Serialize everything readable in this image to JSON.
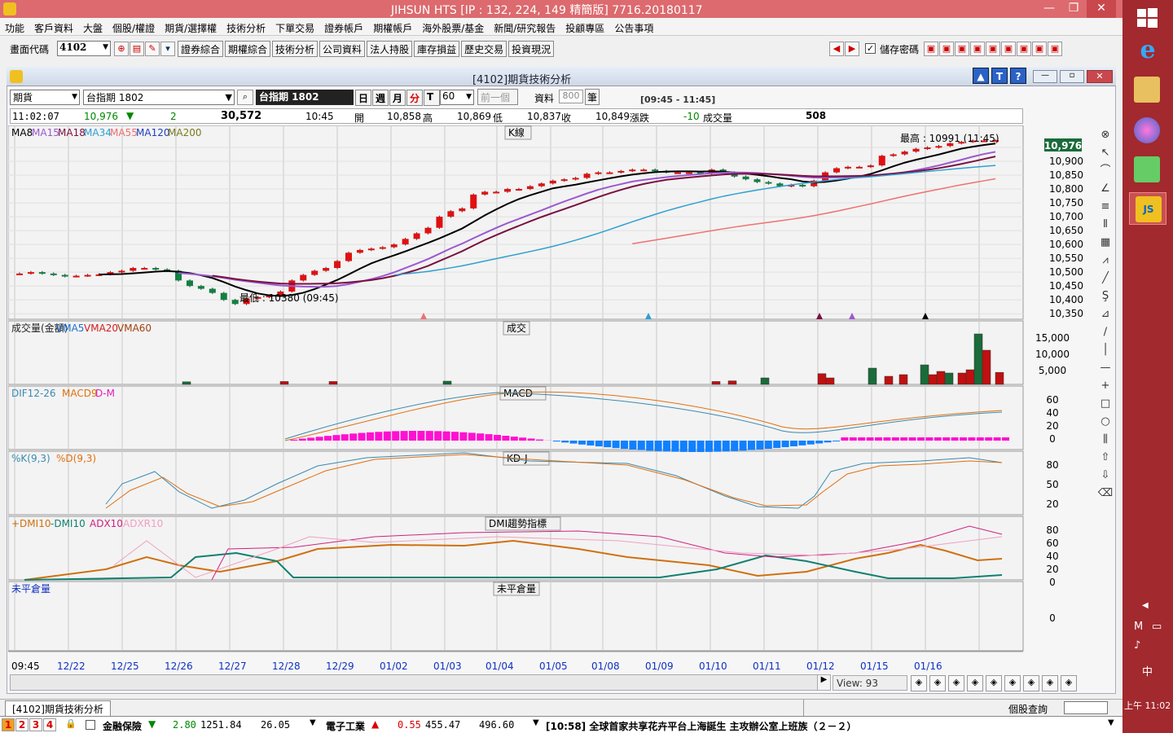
{
  "title": "JIHSUN HTS     [IP : 132, 224, 149 精簡版] 7716.20180117",
  "menu": [
    "功能",
    "客戶資料",
    "大盤",
    "個股/權證",
    "期貨/選擇權",
    "技術分析",
    "下單交易",
    "證券帳戶",
    "期權帳戶",
    "海外股票/基金",
    "新聞/研究報告",
    "投顧專區",
    "公告事項"
  ],
  "toolbar": {
    "code_label": "畫面代碼",
    "code_value": "4102",
    "buttons": [
      "證券綜合",
      "期權綜合",
      "技術分析",
      "公司資料",
      "法人持股",
      "庫存損益",
      "歷史交易",
      "投資現況"
    ],
    "save_pw": "儲存密碼"
  },
  "window": {
    "title": "[4102]期貨技術分析"
  },
  "controls": {
    "type": "期貨",
    "symbol": "台指期 1802",
    "symbol_name": "台指期 1802",
    "periods": [
      "日",
      "週",
      "月",
      "分",
      "T"
    ],
    "interval": "60",
    "prev": "前一個",
    "data_label": "資料",
    "data_count": "800",
    "unit": "筆",
    "range": "[09:45 - 11:45]"
  },
  "quote": {
    "time": "11:02:07",
    "last": "10,976",
    "change": "2",
    "volume_total": "30,572",
    "bar_time": "10:45",
    "open_label": "開",
    "open": "10,858",
    "high_label": "高",
    "high": "10,869",
    "low_label": "低",
    "low": "10,837",
    "close_label": "收",
    "close": "10,849",
    "chg_label": "漲跌",
    "chg": "-10",
    "vol_label": "成交量",
    "vol": "508"
  },
  "price_panel": {
    "legend": [
      "MA8",
      "MA15",
      "MA18",
      "MA34",
      "MA55",
      "MA120",
      "MA200"
    ],
    "legend_colors": [
      "#000000",
      "#9b59d0",
      "#7a1040",
      "#30a0d0",
      "#f07070",
      "#2040c0",
      "#7a7a20"
    ],
    "title": "K線",
    "high_note": "最高 : 10991 (11:45)",
    "low_note": "最低 : 10380 (09:45)",
    "yticks": [
      "10,900",
      "10,850",
      "10,800",
      "10,750",
      "10,700",
      "10,650",
      "10,600",
      "10,550",
      "10,500",
      "10,450",
      "10,400",
      "10,350"
    ],
    "last_badge": "10,976"
  },
  "volume_panel": {
    "legend": [
      "成交量(金額)",
      "VMA5",
      "VMA20",
      "VMA60"
    ],
    "title": "成交",
    "yticks": [
      "15,000",
      "10,000",
      "5,000"
    ]
  },
  "macd_panel": {
    "legend": [
      "DIF12-26",
      "MACD9",
      "D-M"
    ],
    "title": "MACD",
    "yticks": [
      "60",
      "40",
      "20",
      "0"
    ]
  },
  "kd_panel": {
    "legend": [
      "%K(9,3)",
      "%D(9,3)"
    ],
    "title": "KD-J",
    "yticks": [
      "80",
      "50",
      "20"
    ]
  },
  "dmi_panel": {
    "legend": [
      "+DMI10",
      "-DMI10",
      "ADX10",
      "ADXR10"
    ],
    "title": "DMI趨勢指標",
    "yticks": [
      "80",
      "60",
      "40",
      "20",
      "0"
    ]
  },
  "oi_panel": {
    "legend": "未平倉量",
    "title": "未平倉量",
    "yticks": [
      "0"
    ]
  },
  "xaxis": [
    "09:45",
    "12/22",
    "12/25",
    "12/26",
    "12/27",
    "12/28",
    "12/29",
    "01/02",
    "01/03",
    "01/04",
    "01/05",
    "01/08",
    "01/09",
    "01/10",
    "01/11",
    "01/12",
    "01/15",
    "01/16"
  ],
  "view": "View:  93",
  "tab": "[4102]期貨技術分析",
  "stock_query": "個股查詢",
  "bottom": {
    "nums": [
      "1",
      "2",
      "3",
      "4"
    ],
    "item1_name": "金融保險",
    "item1_chg": "2.80",
    "item1_val": "1251.84",
    "item1_vol": "26.05",
    "item2_name": "電子工業",
    "item2_chg": "0.55",
    "item2_val": "455.47",
    "item2_vol": "496.60",
    "news": "[10:58] 全球首家共享花卉平台上海誕生 主攻辦公室上班族（２－２）"
  },
  "taskbar": {
    "ime": "中",
    "clock": "上午 11:02"
  }
}
